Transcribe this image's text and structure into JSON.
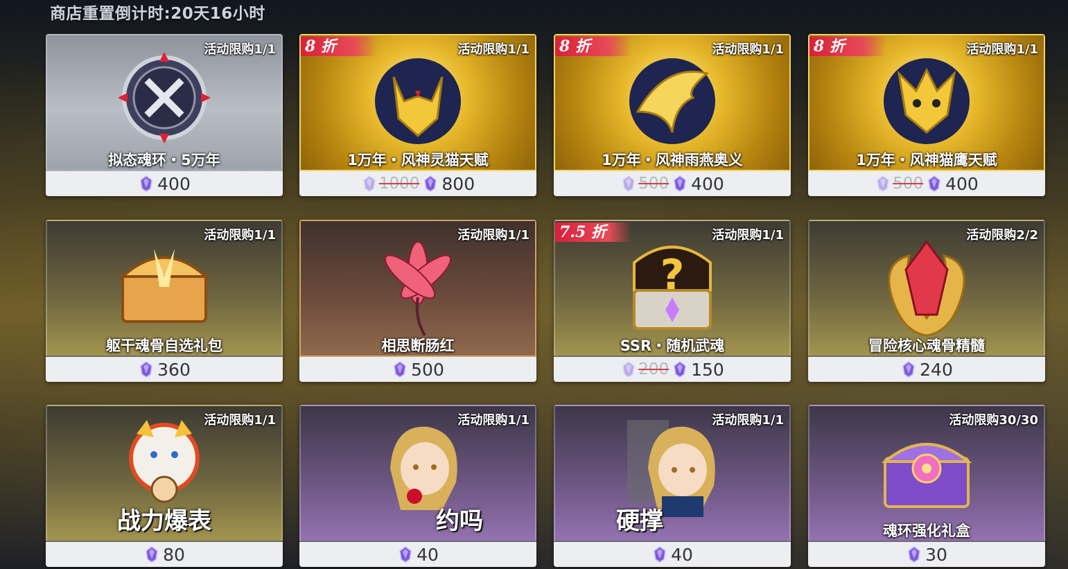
{
  "countdown": "商店重置倒计时:20天16小时",
  "colors": {
    "discount": "#d8203a",
    "gold": "#e8b92c",
    "purple": "#6a5580"
  },
  "items": [
    {
      "name": "拟态魂环・5万年",
      "limit": "活动限购1/1",
      "price": "400",
      "old_price": null,
      "discount": null,
      "style": "silver",
      "icon": "soul-ring-icon"
    },
    {
      "name": "1万年・风神灵猫天赋",
      "limit": "活动限购1/1",
      "price": "800",
      "old_price": "1000",
      "discount": "8 折",
      "style": "gold",
      "icon": "spirit-cat-icon"
    },
    {
      "name": "1万年・风神雨燕奥义",
      "limit": "活动限购1/1",
      "price": "400",
      "old_price": "500",
      "discount": "8 折",
      "style": "gold",
      "icon": "swallow-icon"
    },
    {
      "name": "1万年・风神猫鹰天赋",
      "limit": "活动限购1/1",
      "price": "400",
      "old_price": "500",
      "discount": "8 折",
      "style": "gold",
      "icon": "owl-icon"
    },
    {
      "name": "躯干魂骨自选礼包",
      "limit": "活动限购1/1",
      "price": "360",
      "old_price": null,
      "discount": null,
      "style": "olive",
      "icon": "treasure-chest-icon"
    },
    {
      "name": "相思断肠红",
      "limit": "活动限购1/1",
      "price": "500",
      "old_price": null,
      "discount": null,
      "style": "brown",
      "icon": "red-flower-icon"
    },
    {
      "name": "SSR・随机武魂",
      "limit": "活动限购1/1",
      "price": "150",
      "old_price": "200",
      "discount": "7.5 折",
      "style": "olive",
      "icon": "mystery-chest-icon"
    },
    {
      "name": "冒险核心魂骨精髓",
      "limit": "活动限购2/2",
      "price": "240",
      "old_price": null,
      "discount": null,
      "style": "olive",
      "icon": "red-crystal-icon"
    },
    {
      "name": "战力爆表",
      "limit": "活动限购1/1",
      "price": "80",
      "old_price": null,
      "discount": null,
      "style": "olive",
      "icon": "tiger-sticker-icon",
      "big": true
    },
    {
      "name": "约吗",
      "limit": "活动限购1/1",
      "price": "40",
      "old_price": null,
      "discount": null,
      "style": "purple",
      "icon": "rose-character-icon",
      "big": true
    },
    {
      "name": "硬撑",
      "limit": "活动限购1/1",
      "price": "40",
      "old_price": null,
      "discount": null,
      "style": "purple",
      "icon": "character-sticker-icon",
      "big": true
    },
    {
      "name": "魂环强化礼盒",
      "limit": "活动限购30/30",
      "price": "30",
      "old_price": null,
      "discount": null,
      "style": "purple",
      "icon": "purple-chest-icon"
    }
  ]
}
